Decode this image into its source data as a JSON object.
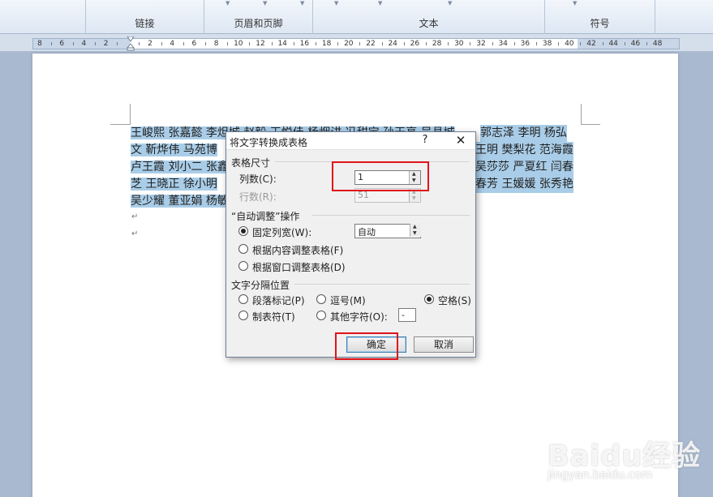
{
  "ribbon": {
    "groups": [
      "链接",
      "页眉和页脚",
      "文本",
      "符号"
    ]
  },
  "ruler": {
    "numbers": [
      "8",
      "6",
      "4",
      "2",
      "",
      "2",
      "4",
      "6",
      "8",
      "10",
      "12",
      "14",
      "16",
      "18",
      "20",
      "22",
      "24",
      "26",
      "28",
      "30",
      "32",
      "34",
      "36",
      "38",
      "40",
      "42",
      "44",
      "46",
      "48"
    ]
  },
  "document": {
    "lines": [
      [
        "王峻熙 张嘉懿 李炟城 赵毅 王悦佳 杨烟讲 冯甜宝 孙天亮 吴县城",
        "郭志泽 李明 杨弘"
      ],
      [
        "文 靳烨伟 马苑博",
        "王明 樊梨花 范海霞"
      ],
      [
        "卢王霞 刘小二 张鑫",
        "吴莎莎 严夏红 闫春"
      ],
      [
        "芝 王晓正 徐小明",
        "春芳 王媛媛 张秀艳"
      ],
      [
        "吴少耀 董亚娟 杨敏",
        ""
      ]
    ],
    "paragraph_mark": "↵"
  },
  "dialog": {
    "title": "将文字转换成表格",
    "help": "?",
    "close": "✕",
    "table_size_label": "表格尺寸",
    "columns_label": "列数(C):",
    "columns_value": "1",
    "rows_label": "行数(R):",
    "rows_value": "51",
    "autofit_label": "“自动调整”操作",
    "fixed_width_label": "固定列宽(W):",
    "fixed_width_value": "自动",
    "autofit_content_label": "根据内容调整表格(F)",
    "autofit_window_label": "根据窗口调整表格(D)",
    "separator_label": "文字分隔位置",
    "paragraph_label": "段落标记(P)",
    "comma_label": "逗号(M)",
    "space_label": "空格(S)",
    "tab_label": "制表符(T)",
    "other_label": "其他字符(O):",
    "other_value": "-",
    "ok_label": "确定",
    "cancel_label": "取消"
  },
  "watermark": {
    "logo_text": "Baidu经验",
    "url": "jingyan.baidu.com"
  },
  "colors": {
    "selection": "#a9cde8",
    "highlight_box": "#e0141b",
    "workspace": "#a9b9cf"
  }
}
